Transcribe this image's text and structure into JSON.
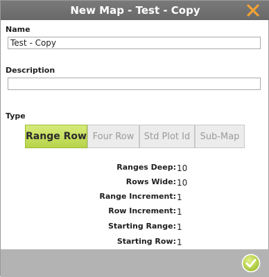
{
  "dialog": {
    "title": "New Map - Test - Copy",
    "close_icon": "close-x-icon",
    "accent_color": "#f4a233"
  },
  "name": {
    "label": "Name",
    "value": "Test - Copy"
  },
  "description": {
    "label": "Description",
    "value": ""
  },
  "type": {
    "label": "Type",
    "options": [
      "Range Row",
      "Four Row",
      "Std Plot Id",
      "Sub-Map"
    ],
    "selected": "Range Row",
    "selected_color": "#c0d95a"
  },
  "params": [
    {
      "label": "Ranges Deep:",
      "value": "10"
    },
    {
      "label": "Rows Wide:",
      "value": "10"
    },
    {
      "label": "Range Increment:",
      "value": "1"
    },
    {
      "label": "Row Increment:",
      "value": "1"
    },
    {
      "label": "Starting Range:",
      "value": "1"
    },
    {
      "label": "Starting Row:",
      "value": "1"
    }
  ],
  "footer": {
    "confirm_icon": "check-circle-icon"
  }
}
